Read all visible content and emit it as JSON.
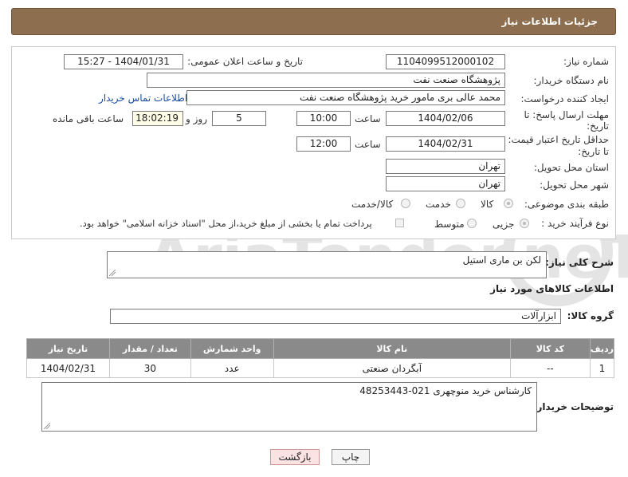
{
  "header": {
    "title": "جزئیات اطلاعات نیاز"
  },
  "form": {
    "need_number": {
      "label": "شماره نیاز:",
      "value": "1104099512000102"
    },
    "announce": {
      "label": "تاریخ و ساعت اعلان عمومی:",
      "value": "1404/01/31 - 15:27"
    },
    "buyer_org": {
      "label": "نام دستگاه خریدار:",
      "value": "پژوهشگاه صنعت نفت"
    },
    "creator": {
      "label": "ایجاد کننده درخواست:",
      "value": "محمد عالی برى مامور خرید پژوهشگاه صنعت نفت",
      "contact_link": "اطلاعات تماس خریدار"
    },
    "reply_deadline": {
      "label_line1": "مهلت ارسال پاسخ: تا",
      "label_line2": "تاریخ:",
      "date": "1404/02/06",
      "time_label": "ساعت",
      "time": "10:00",
      "days": "5",
      "days_label": "روز و",
      "remaining": "18:02:19",
      "remaining_label": "ساعت باقی مانده"
    },
    "price_validity": {
      "label_line1": "حداقل تاریخ اعتبار قیمت:",
      "label_line2": "تا تاریخ:",
      "date": "1404/02/31",
      "time_label": "ساعت",
      "time": "12:00"
    },
    "province": {
      "label": "استان محل تحویل:",
      "value": "تهران"
    },
    "city": {
      "label": "شهر محل تحویل:",
      "value": "تهران"
    },
    "category": {
      "label": "طبقه بندی موضوعی:",
      "options": [
        "کالا",
        "خدمت",
        "کالا/خدمت"
      ]
    },
    "process": {
      "label": "نوع فرآیند خرید :",
      "options": [
        "جزیی",
        "متوسط"
      ],
      "note": "پرداخت تمام یا بخشی از مبلغ خرید،از محل \"اسناد خزانه اسلامی\" خواهد بود."
    }
  },
  "description": {
    "label": "شرح کلی نیاز:",
    "value": "لکن بن ماری استیل"
  },
  "goods": {
    "section_title": "اطلاعات کالاهای مورد نیاز",
    "group_label": "گروه کالا:",
    "group_value": "ابزارآلات",
    "columns": [
      "ردیف",
      "کد کالا",
      "نام کالا",
      "واحد شمارش",
      "تعداد / مقدار",
      "تاریخ نیاز"
    ],
    "rows": [
      {
        "index": "1",
        "code": "--",
        "name": "آبگردان صنعتی",
        "unit": "عدد",
        "qty": "30",
        "date": "1404/02/31"
      }
    ]
  },
  "buyer_notes": {
    "label": "توضیحات خریدار:",
    "value": "کارشناس خرید منوچهری 021-48253443"
  },
  "buttons": {
    "print": "چاپ",
    "back": "بازگشت"
  },
  "watermark": {
    "text": "AriaTender.neT"
  }
}
